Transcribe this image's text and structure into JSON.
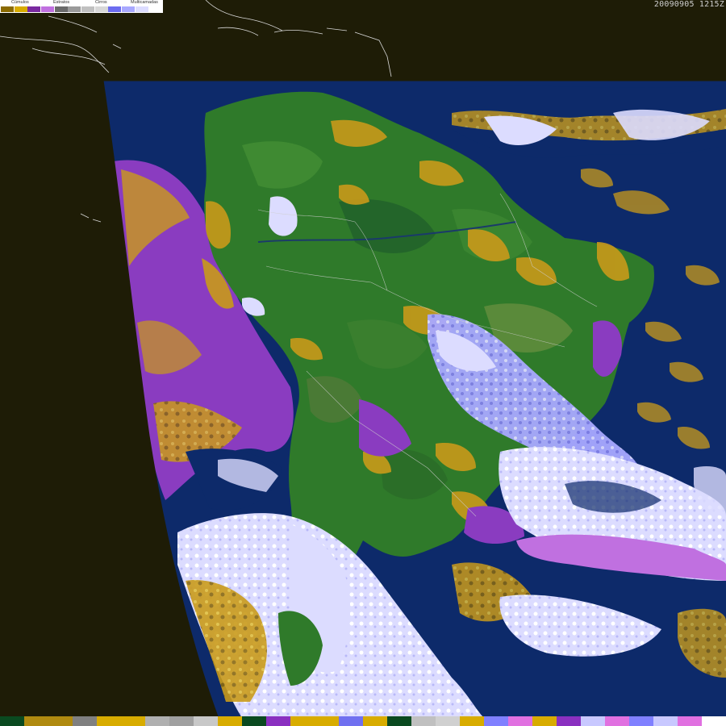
{
  "timestamp": "20090905 1215Z",
  "legend": {
    "labels": [
      "Cúmulos",
      "Estratos",
      "Cirros",
      "Multicamadas"
    ],
    "swatches": [
      "#8a6a00",
      "#d8ac00",
      "#7a2aa0",
      "#c070e0",
      "#6a6a6a",
      "#9a9a9a",
      "#c0c0c0",
      "#d8d8d8",
      "#6c6cf0",
      "#a8a8ff",
      "#dcdcff",
      "#ffffff"
    ]
  },
  "bottom_bar": [
    "#0a4a20",
    "#b08a10",
    "#b08a10",
    "#808080",
    "#d8ac00",
    "#d8ac00",
    "#b0b0b0",
    "#a0a0a0",
    "#c8c8c8",
    "#d8ac00",
    "#0a4a20",
    "#8a30c0",
    "#d8ac00",
    "#d8ac00",
    "#7070f0",
    "#d8ac00",
    "#0a4a20",
    "#c0c0c0",
    "#d0d0d0",
    "#d8ac00",
    "#8080ff",
    "#e070e0",
    "#d8ac00",
    "#8a30c0",
    "#c8c8ff",
    "#e070e0",
    "#8080ff",
    "#c8c8ff",
    "#e070e0",
    "#ffffff"
  ],
  "colors": {
    "space": "#1e1c06",
    "ocean": "#0d2a6a",
    "land": "#2f7a2a",
    "low_cloud": "#c99a1a",
    "stratus": "#8a3cc0",
    "cirrus": "#a8a8ff",
    "multilayer": "#dcdcff"
  }
}
